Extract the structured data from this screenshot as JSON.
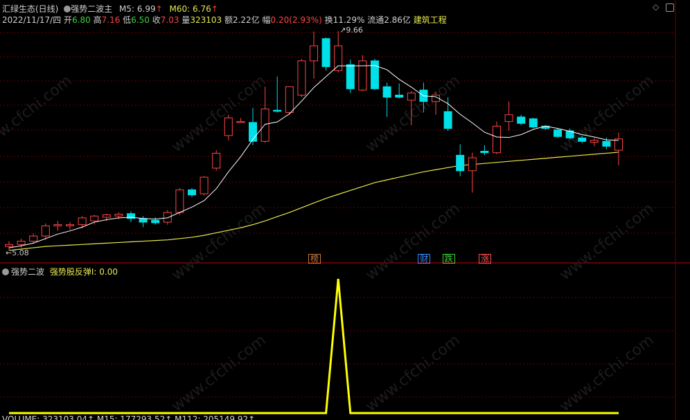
{
  "header": {
    "title": "汇绿生态(日线)",
    "indicator_name": "强势二波主",
    "m5_label": "M5:",
    "m5_value": "6.99",
    "m60_label": "M60:",
    "m60_value": "6.76",
    "arrow": "↑"
  },
  "quote": {
    "date": "2022/11/17/四",
    "open_label": "开",
    "open": "6.80",
    "high_label": "高",
    "high": "7.16",
    "low_label": "低",
    "low": "6.50",
    "close_label": "收",
    "close": "7.03",
    "volume_label": "量",
    "volume": "323103",
    "amount_label": "额",
    "amount": "2.22亿",
    "change_label": "幅",
    "change": "0.20(2.93%)",
    "turnover_label": "换",
    "turnover": "11.29%",
    "float_label": "流通",
    "float": "2.86亿",
    "sector": "建筑工程"
  },
  "annotations": {
    "high_price": "9.66",
    "low_price": "5.08",
    "markers": [
      {
        "label": "榜",
        "color": "#c87a3c"
      },
      {
        "label": "财",
        "color": "#3c8cff"
      },
      {
        "label": "跌",
        "color": "#3cd23c"
      },
      {
        "label": "涨",
        "color": "#ff5050"
      }
    ]
  },
  "sub_panel": {
    "name": "强势二波",
    "line_label": "强势股反弹I:",
    "line_value": "0.00"
  },
  "bottom_bar": {
    "text": "VOLUME: 323103.04↑ M15: 177293.52↑ M112: 205149.92↑"
  },
  "watermark": "www.cfchi.com",
  "colors": {
    "up": "#ff4646",
    "down": "#00e0e8",
    "ma5": "#ffffff",
    "ma60": "#e8e850",
    "signal": "#ffff00",
    "grid": "#700000"
  },
  "chart_data": {
    "type": "candlestick",
    "price_scale": "log",
    "candles": [
      {
        "o": 5.12,
        "h": 5.2,
        "l": 5.06,
        "c": 5.15
      },
      {
        "o": 5.15,
        "h": 5.24,
        "l": 5.1,
        "c": 5.2
      },
      {
        "o": 5.2,
        "h": 5.32,
        "l": 5.16,
        "c": 5.28
      },
      {
        "o": 5.28,
        "h": 5.48,
        "l": 5.22,
        "c": 5.44
      },
      {
        "o": 5.44,
        "h": 5.52,
        "l": 5.36,
        "c": 5.46
      },
      {
        "o": 5.44,
        "h": 5.5,
        "l": 5.38,
        "c": 5.46
      },
      {
        "o": 5.46,
        "h": 5.6,
        "l": 5.4,
        "c": 5.57
      },
      {
        "o": 5.52,
        "h": 5.62,
        "l": 5.46,
        "c": 5.6
      },
      {
        "o": 5.58,
        "h": 5.64,
        "l": 5.52,
        "c": 5.62
      },
      {
        "o": 5.6,
        "h": 5.66,
        "l": 5.55,
        "c": 5.63
      },
      {
        "o": 5.64,
        "h": 5.68,
        "l": 5.5,
        "c": 5.56
      },
      {
        "o": 5.56,
        "h": 5.6,
        "l": 5.42,
        "c": 5.5
      },
      {
        "o": 5.53,
        "h": 5.58,
        "l": 5.46,
        "c": 5.49
      },
      {
        "o": 5.5,
        "h": 5.7,
        "l": 5.46,
        "c": 5.66
      },
      {
        "o": 5.66,
        "h": 6.08,
        "l": 5.62,
        "c": 6.05
      },
      {
        "o": 6.05,
        "h": 6.08,
        "l": 5.92,
        "c": 5.96
      },
      {
        "o": 5.98,
        "h": 6.3,
        "l": 5.95,
        "c": 6.28
      },
      {
        "o": 6.45,
        "h": 6.8,
        "l": 6.4,
        "c": 6.74
      },
      {
        "o": 7.1,
        "h": 7.55,
        "l": 7.0,
        "c": 7.48
      },
      {
        "o": 7.4,
        "h": 7.48,
        "l": 7.38,
        "c": 7.4
      },
      {
        "o": 7.38,
        "h": 7.7,
        "l": 6.9,
        "c": 6.98
      },
      {
        "o": 6.98,
        "h": 8.2,
        "l": 6.95,
        "c": 7.68
      },
      {
        "o": 7.65,
        "h": 8.45,
        "l": 7.6,
        "c": 7.64
      },
      {
        "o": 7.6,
        "h": 8.2,
        "l": 7.55,
        "c": 8.2
      },
      {
        "o": 8.0,
        "h": 8.9,
        "l": 7.95,
        "c": 8.85
      },
      {
        "o": 8.85,
        "h": 9.65,
        "l": 8.4,
        "c": 9.25
      },
      {
        "o": 9.45,
        "h": 9.48,
        "l": 8.6,
        "c": 8.7
      },
      {
        "o": 8.6,
        "h": 9.66,
        "l": 8.55,
        "c": 9.25
      },
      {
        "o": 8.75,
        "h": 8.88,
        "l": 8.05,
        "c": 8.15
      },
      {
        "o": 8.12,
        "h": 9.0,
        "l": 8.1,
        "c": 8.85
      },
      {
        "o": 8.85,
        "h": 8.9,
        "l": 8.12,
        "c": 8.15
      },
      {
        "o": 8.2,
        "h": 8.3,
        "l": 7.5,
        "c": 7.95
      },
      {
        "o": 8.0,
        "h": 8.28,
        "l": 7.92,
        "c": 7.95
      },
      {
        "o": 7.88,
        "h": 8.1,
        "l": 7.32,
        "c": 8.05
      },
      {
        "o": 8.12,
        "h": 8.3,
        "l": 7.6,
        "c": 7.85
      },
      {
        "o": 7.85,
        "h": 8.08,
        "l": 7.55,
        "c": 8.0
      },
      {
        "o": 7.62,
        "h": 7.95,
        "l": 7.2,
        "c": 7.25
      },
      {
        "o": 6.7,
        "h": 6.92,
        "l": 6.3,
        "c": 6.4
      },
      {
        "o": 6.4,
        "h": 6.75,
        "l": 6.0,
        "c": 6.65
      },
      {
        "o": 6.78,
        "h": 6.9,
        "l": 6.7,
        "c": 6.75
      },
      {
        "o": 6.75,
        "h": 7.4,
        "l": 6.72,
        "c": 7.3
      },
      {
        "o": 7.4,
        "h": 7.85,
        "l": 7.2,
        "c": 7.55
      },
      {
        "o": 7.5,
        "h": 7.55,
        "l": 7.32,
        "c": 7.36
      },
      {
        "o": 7.46,
        "h": 7.48,
        "l": 7.25,
        "c": 7.28
      },
      {
        "o": 7.3,
        "h": 7.32,
        "l": 7.22,
        "c": 7.25
      },
      {
        "o": 7.22,
        "h": 7.26,
        "l": 7.05,
        "c": 7.08
      },
      {
        "o": 7.2,
        "h": 7.25,
        "l": 7.02,
        "c": 7.05
      },
      {
        "o": 7.05,
        "h": 7.1,
        "l": 6.94,
        "c": 6.98
      },
      {
        "o": 6.96,
        "h": 7.05,
        "l": 6.88,
        "c": 7.0
      },
      {
        "o": 6.98,
        "h": 7.06,
        "l": 6.82,
        "c": 6.88
      },
      {
        "o": 6.8,
        "h": 7.16,
        "l": 6.5,
        "c": 7.03
      }
    ],
    "ma5": [
      5.1,
      5.13,
      5.17,
      5.24,
      5.31,
      5.36,
      5.42,
      5.5,
      5.54,
      5.57,
      5.58,
      5.56,
      5.55,
      5.57,
      5.66,
      5.75,
      5.86,
      6.07,
      6.38,
      6.67,
      7.02,
      7.34,
      7.39,
      7.57,
      7.86,
      8.18,
      8.45,
      8.72,
      8.72,
      8.72,
      8.73,
      8.62,
      8.38,
      8.19,
      7.98,
      7.96,
      7.8,
      7.56,
      7.37,
      7.17,
      7.07,
      7.06,
      7.12,
      7.23,
      7.3,
      7.25,
      7.19,
      7.12,
      7.07,
      7.01,
      7.0
    ],
    "ma60": [
      5.06,
      5.08,
      5.1,
      5.12,
      5.13,
      5.14,
      5.15,
      5.16,
      5.17,
      5.18,
      5.19,
      5.2,
      5.21,
      5.22,
      5.24,
      5.26,
      5.29,
      5.33,
      5.37,
      5.41,
      5.46,
      5.52,
      5.59,
      5.66,
      5.74,
      5.82,
      5.9,
      5.97,
      6.04,
      6.11,
      6.18,
      6.23,
      6.28,
      6.33,
      6.38,
      6.42,
      6.46,
      6.5,
      6.52,
      6.54,
      6.56,
      6.58,
      6.6,
      6.62,
      6.64,
      6.66,
      6.68,
      6.7,
      6.72,
      6.74,
      6.76
    ],
    "signal": {
      "x_range": [
        0,
        50
      ],
      "y_range": [
        0,
        1
      ],
      "spike_index": 27,
      "spike_value": 1,
      "baseline": 0
    },
    "markers_index": {
      "榜": 25,
      "财": 34,
      "跌": 36,
      "涨": 39
    }
  }
}
